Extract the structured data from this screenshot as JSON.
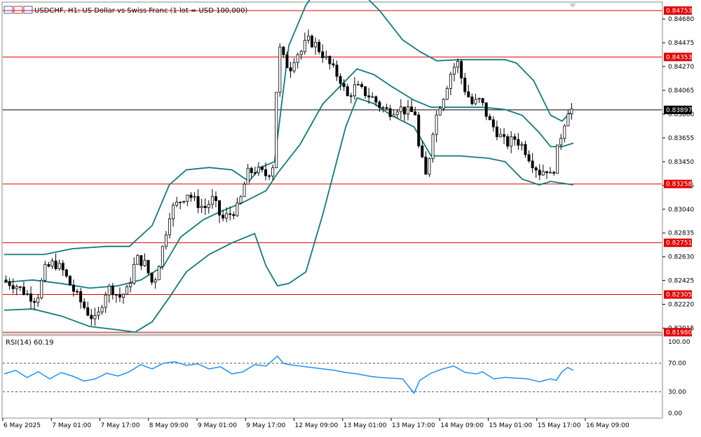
{
  "header": {
    "title": "USDCHF, H1:  US Dollar vs Swiss Franc  (1 lot = USD 100,000)"
  },
  "rsi": {
    "label": "RSI(14) 60.19",
    "levels_labels": [
      "100.00",
      "70.00",
      "30.00",
      "0.00"
    ]
  },
  "price_axis": {
    "ticks": [
      "0.84680",
      "0.84475",
      "0.84270",
      "0.84065",
      "0.83860",
      "0.83655",
      "0.83450",
      "0.83245",
      "0.83040",
      "0.82835",
      "0.82630",
      "0.82425",
      "0.82220",
      "0.82015"
    ]
  },
  "time_axis": {
    "ticks": [
      "6 May 2025",
      "7 May 01:00",
      "7 May 17:00",
      "8 May 09:00",
      "9 May 01:00",
      "9 May 17:00",
      "12 May 09:00",
      "13 May 01:00",
      "13 May 17:00",
      "14 May 09:00",
      "15 May 01:00",
      "15 May 17:00",
      "16 May 09:00"
    ]
  },
  "colors": {
    "bull_candle": "#ffffff",
    "bear_candle": "#000000",
    "bands": "#117a7a",
    "rsi_line": "#1e90ff",
    "level_line": "#e00000",
    "current_line": "#000000"
  },
  "chart_data": {
    "type": "candlestick",
    "symbol": "USDCHF",
    "timeframe": "H1",
    "ylim": [
      0.8197,
      0.8482
    ],
    "current_price": "0.83897",
    "horizontal_levels": [
      "0.84753",
      "0.84353",
      "0.83258",
      "0.82751",
      "0.82305",
      "0.81980"
    ],
    "close_path": [
      [
        0,
        0.8243
      ],
      [
        0.025,
        0.8238
      ],
      [
        0.045,
        0.823
      ],
      [
        0.06,
        0.8226
      ],
      [
        0.075,
        0.8252
      ],
      [
        0.09,
        0.8258
      ],
      [
        0.105,
        0.8252
      ],
      [
        0.12,
        0.8238
      ],
      [
        0.135,
        0.8226
      ],
      [
        0.15,
        0.8215
      ],
      [
        0.165,
        0.8207
      ],
      [
        0.18,
        0.8232
      ],
      [
        0.19,
        0.8237
      ],
      [
        0.205,
        0.8228
      ],
      [
        0.22,
        0.8234
      ],
      [
        0.235,
        0.8262
      ],
      [
        0.25,
        0.8257
      ],
      [
        0.265,
        0.8238
      ],
      [
        0.28,
        0.8268
      ],
      [
        0.295,
        0.8303
      ],
      [
        0.31,
        0.831
      ],
      [
        0.325,
        0.8318
      ],
      [
        0.34,
        0.831
      ],
      [
        0.355,
        0.8305
      ],
      [
        0.37,
        0.8313
      ],
      [
        0.385,
        0.8295
      ],
      [
        0.4,
        0.83
      ],
      [
        0.415,
        0.8306
      ],
      [
        0.43,
        0.8335
      ],
      [
        0.445,
        0.8338
      ],
      [
        0.465,
        0.8333
      ],
      [
        0.475,
        0.8342
      ],
      [
        0.485,
        0.8445
      ],
      [
        0.495,
        0.8432
      ],
      [
        0.505,
        0.8425
      ],
      [
        0.515,
        0.8438
      ],
      [
        0.525,
        0.844
      ],
      [
        0.535,
        0.845
      ],
      [
        0.55,
        0.8446
      ],
      [
        0.565,
        0.8436
      ],
      [
        0.58,
        0.8425
      ],
      [
        0.595,
        0.8415
      ],
      [
        0.605,
        0.84
      ],
      [
        0.62,
        0.841
      ],
      [
        0.635,
        0.8405
      ],
      [
        0.65,
        0.84
      ],
      [
        0.665,
        0.8392
      ],
      [
        0.68,
        0.8388
      ],
      [
        0.695,
        0.8392
      ],
      [
        0.71,
        0.8388
      ],
      [
        0.725,
        0.8387
      ],
      [
        0.73,
        0.836
      ],
      [
        0.745,
        0.833
      ],
      [
        0.755,
        0.837
      ],
      [
        0.765,
        0.839
      ],
      [
        0.775,
        0.8402
      ],
      [
        0.79,
        0.8425
      ],
      [
        0.8,
        0.843
      ],
      [
        0.81,
        0.841
      ],
      [
        0.825,
        0.8395
      ],
      [
        0.84,
        0.8398
      ],
      [
        0.855,
        0.838
      ],
      [
        0.87,
        0.837
      ],
      [
        0.885,
        0.836
      ],
      [
        0.9,
        0.8365
      ],
      [
        0.915,
        0.8358
      ],
      [
        0.93,
        0.8345
      ],
      [
        0.945,
        0.8335
      ],
      [
        0.955,
        0.834
      ],
      [
        0.965,
        0.833
      ],
      [
        0.975,
        0.8355
      ],
      [
        0.985,
        0.8375
      ],
      [
        0.995,
        0.8392
      ],
      [
        1.0,
        0.839
      ]
    ],
    "bollinger_upper": [
      [
        0,
        0.8265
      ],
      [
        0.07,
        0.8265
      ],
      [
        0.12,
        0.827
      ],
      [
        0.18,
        0.8272
      ],
      [
        0.22,
        0.8272
      ],
      [
        0.26,
        0.829
      ],
      [
        0.29,
        0.8325
      ],
      [
        0.32,
        0.8338
      ],
      [
        0.36,
        0.834
      ],
      [
        0.4,
        0.8338
      ],
      [
        0.43,
        0.8328
      ],
      [
        0.45,
        0.834
      ],
      [
        0.475,
        0.8345
      ],
      [
        0.5,
        0.8445
      ],
      [
        0.53,
        0.848
      ],
      [
        0.56,
        0.85
      ],
      [
        0.6,
        0.851
      ],
      [
        0.63,
        0.849
      ],
      [
        0.66,
        0.8475
      ],
      [
        0.7,
        0.845
      ],
      [
        0.73,
        0.844
      ],
      [
        0.76,
        0.8432
      ],
      [
        0.8,
        0.8433
      ],
      [
        0.84,
        0.8433
      ],
      [
        0.88,
        0.8433
      ],
      [
        0.9,
        0.843
      ],
      [
        0.93,
        0.8415
      ],
      [
        0.96,
        0.8385
      ],
      [
        0.98,
        0.838
      ],
      [
        1.0,
        0.839
      ]
    ],
    "bollinger_middle": [
      [
        0,
        0.8241
      ],
      [
        0.05,
        0.8243
      ],
      [
        0.1,
        0.824
      ],
      [
        0.15,
        0.8236
      ],
      [
        0.2,
        0.8238
      ],
      [
        0.24,
        0.8243
      ],
      [
        0.28,
        0.8255
      ],
      [
        0.31,
        0.828
      ],
      [
        0.35,
        0.8295
      ],
      [
        0.38,
        0.8302
      ],
      [
        0.42,
        0.831
      ],
      [
        0.46,
        0.832
      ],
      [
        0.48,
        0.8335
      ],
      [
        0.52,
        0.836
      ],
      [
        0.56,
        0.8395
      ],
      [
        0.6,
        0.8415
      ],
      [
        0.62,
        0.8425
      ],
      [
        0.65,
        0.842
      ],
      [
        0.68,
        0.841
      ],
      [
        0.72,
        0.8398
      ],
      [
        0.75,
        0.8392
      ],
      [
        0.8,
        0.8392
      ],
      [
        0.84,
        0.8392
      ],
      [
        0.88,
        0.839
      ],
      [
        0.91,
        0.8385
      ],
      [
        0.94,
        0.837
      ],
      [
        0.96,
        0.8358
      ],
      [
        0.98,
        0.8358
      ],
      [
        1.0,
        0.8361
      ]
    ],
    "bollinger_lower": [
      [
        0,
        0.8217
      ],
      [
        0.05,
        0.8218
      ],
      [
        0.1,
        0.8212
      ],
      [
        0.15,
        0.8203
      ],
      [
        0.2,
        0.82
      ],
      [
        0.23,
        0.8198
      ],
      [
        0.26,
        0.8207
      ],
      [
        0.29,
        0.8228
      ],
      [
        0.32,
        0.825
      ],
      [
        0.36,
        0.8265
      ],
      [
        0.4,
        0.8275
      ],
      [
        0.44,
        0.8283
      ],
      [
        0.46,
        0.8255
      ],
      [
        0.48,
        0.8238
      ],
      [
        0.5,
        0.824
      ],
      [
        0.53,
        0.825
      ],
      [
        0.56,
        0.83
      ],
      [
        0.6,
        0.8375
      ],
      [
        0.62,
        0.84
      ],
      [
        0.65,
        0.8395
      ],
      [
        0.68,
        0.8385
      ],
      [
        0.72,
        0.8375
      ],
      [
        0.75,
        0.835
      ],
      [
        0.8,
        0.835
      ],
      [
        0.85,
        0.8348
      ],
      [
        0.88,
        0.8345
      ],
      [
        0.91,
        0.833
      ],
      [
        0.94,
        0.8325
      ],
      [
        0.96,
        0.8328
      ],
      [
        1.0,
        0.8325
      ]
    ],
    "rsi_values": [
      [
        0,
        55
      ],
      [
        0.02,
        60
      ],
      [
        0.04,
        50
      ],
      [
        0.06,
        58
      ],
      [
        0.08,
        48
      ],
      [
        0.1,
        57
      ],
      [
        0.12,
        52
      ],
      [
        0.14,
        45
      ],
      [
        0.16,
        48
      ],
      [
        0.18,
        56
      ],
      [
        0.2,
        52
      ],
      [
        0.22,
        58
      ],
      [
        0.24,
        68
      ],
      [
        0.26,
        62
      ],
      [
        0.28,
        70
      ],
      [
        0.3,
        72
      ],
      [
        0.32,
        67
      ],
      [
        0.34,
        69
      ],
      [
        0.36,
        62
      ],
      [
        0.38,
        65
      ],
      [
        0.4,
        55
      ],
      [
        0.42,
        58
      ],
      [
        0.44,
        68
      ],
      [
        0.46,
        66
      ],
      [
        0.48,
        80
      ],
      [
        0.49,
        70
      ],
      [
        0.5,
        68
      ],
      [
        0.52,
        66
      ],
      [
        0.54,
        64
      ],
      [
        0.56,
        62
      ],
      [
        0.58,
        60
      ],
      [
        0.6,
        57
      ],
      [
        0.62,
        55
      ],
      [
        0.64,
        52
      ],
      [
        0.66,
        50
      ],
      [
        0.68,
        49
      ],
      [
        0.7,
        48
      ],
      [
        0.72,
        28
      ],
      [
        0.73,
        46
      ],
      [
        0.75,
        56
      ],
      [
        0.77,
        62
      ],
      [
        0.79,
        66
      ],
      [
        0.81,
        57
      ],
      [
        0.83,
        55
      ],
      [
        0.84,
        58
      ],
      [
        0.86,
        48
      ],
      [
        0.88,
        50
      ],
      [
        0.9,
        49
      ],
      [
        0.92,
        48
      ],
      [
        0.94,
        44
      ],
      [
        0.96,
        48
      ],
      [
        0.97,
        46
      ],
      [
        0.98,
        58
      ],
      [
        0.99,
        64
      ],
      [
        1.0,
        60
      ]
    ]
  }
}
